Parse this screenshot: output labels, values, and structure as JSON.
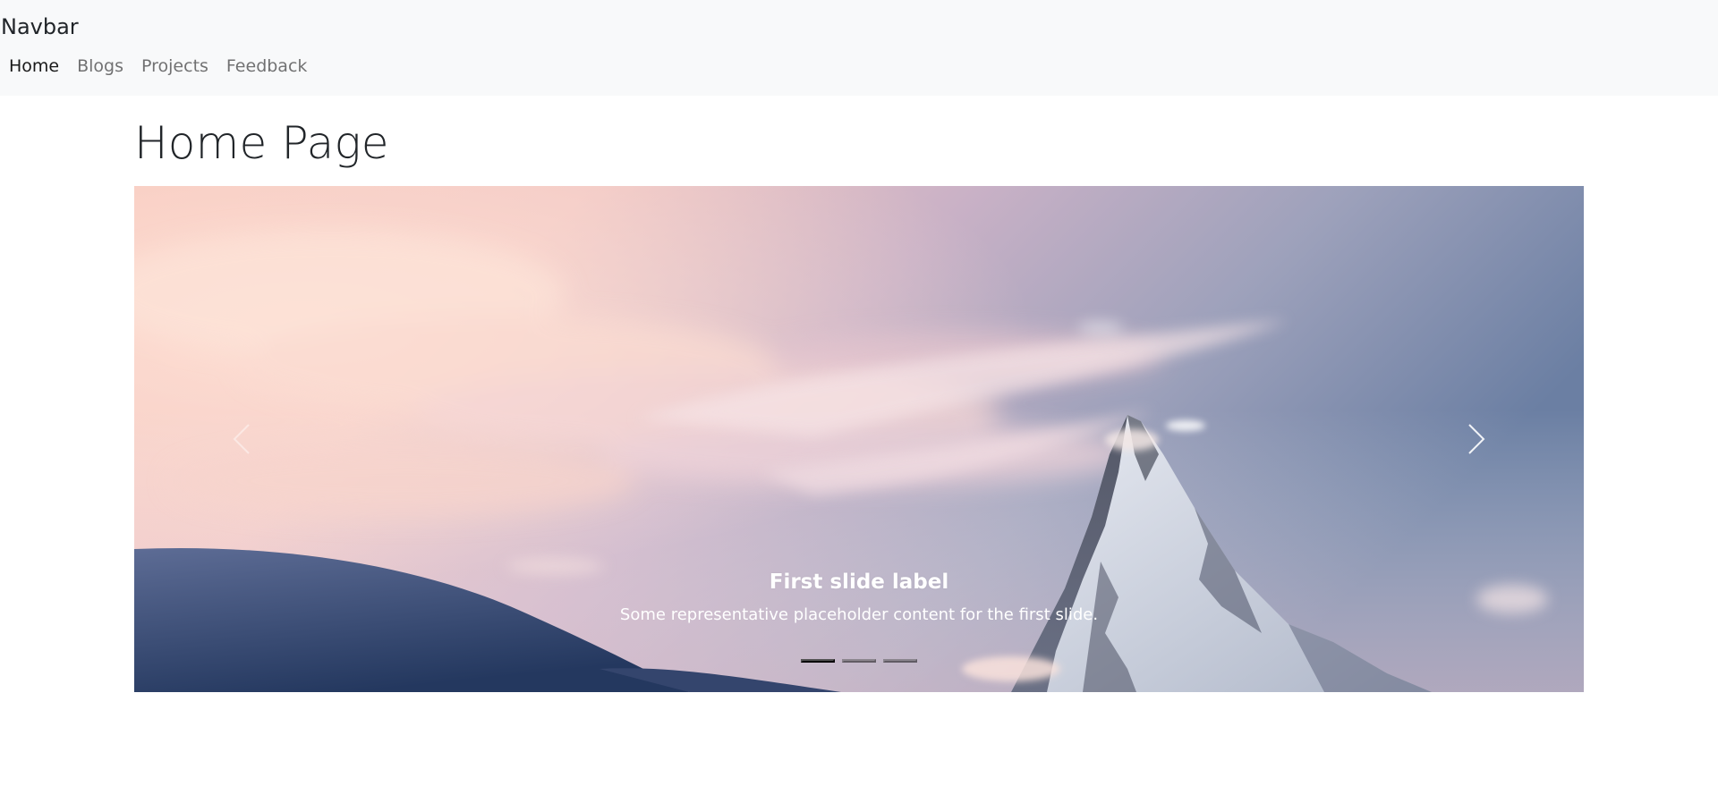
{
  "navbar": {
    "brand": "Navbar",
    "links": [
      {
        "label": "Home",
        "active": true
      },
      {
        "label": "Blogs",
        "active": false
      },
      {
        "label": "Projects",
        "active": false
      },
      {
        "label": "Feedback",
        "active": false
      }
    ]
  },
  "main": {
    "title": "Home Page"
  },
  "carousel": {
    "slides": [
      {
        "label": "First slide label",
        "text": "Some representative placeholder content for the first slide."
      }
    ],
    "slide_count": 3,
    "active_index": 0,
    "prev_icon": "chevron-left-icon",
    "next_icon": "chevron-right-icon"
  },
  "colors": {
    "navbar_bg": "#f8f9fa",
    "nav_active": "#1b1b1b",
    "nav_inactive": "#6c6c6c",
    "sky_pink": "#f4c5be",
    "sky_blue": "#6b7fa3"
  }
}
